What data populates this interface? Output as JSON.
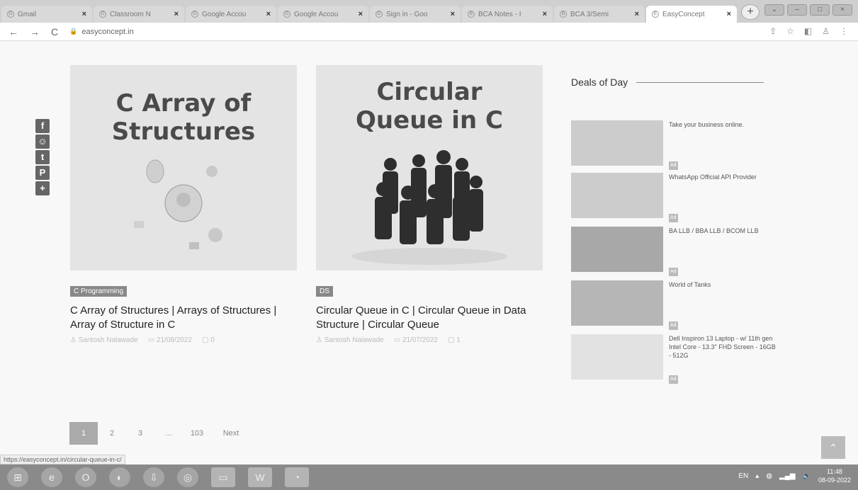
{
  "browser": {
    "tabs": [
      {
        "label": "Gmail",
        "icon": "G"
      },
      {
        "label": "Classroom N",
        "icon": "G"
      },
      {
        "label": "Google Accou",
        "icon": "G"
      },
      {
        "label": "Google Accou",
        "icon": "G"
      },
      {
        "label": "Sign in - Goo",
        "icon": "G"
      },
      {
        "label": "BCA Notes - I",
        "icon": "B"
      },
      {
        "label": "BCA 3/Semi",
        "icon": "B"
      },
      {
        "label": "EasyConcept",
        "icon": "E"
      }
    ],
    "new_tab": "+",
    "url": "easyconcept.in"
  },
  "share_icons": [
    "f",
    "☺",
    "t",
    "P",
    "+"
  ],
  "posts": [
    {
      "thumb_title": "C Array of Structures",
      "category": "C Programming",
      "title": "C Array of Structures | Arrays of Structures | Array of Structure in C",
      "author": "Santosh Nalawade",
      "date": "21/08/2022",
      "comments": "0"
    },
    {
      "thumb_title": "Circular Queue in C",
      "category": "DS",
      "title": "Circular Queue in C | Circular Queue in Data Structure | Circular Queue",
      "author": "Santosh Nalawade",
      "date": "21/07/2022",
      "comments": "1"
    }
  ],
  "sidebar": {
    "title": "Deals of Day",
    "deals": [
      {
        "text": "Take your business online."
      },
      {
        "text": "WhatsApp Official API Provider"
      },
      {
        "text": "BA LLB / BBA LLB / BCOM LLB"
      },
      {
        "text": "World of Tanks"
      },
      {
        "text": "Dell Inspiron 13 Laptop - w/ 11th gen Intel Core - 13.3\" FHD Screen - 16GB - 512G"
      }
    ]
  },
  "pagination": {
    "pages": [
      "1",
      "2",
      "3",
      "...",
      "103"
    ],
    "next": "Next"
  },
  "status_url": "https://easyconcept.in/circular-queue-in-c/",
  "taskbar": {
    "lang": "EN",
    "time": "11:48",
    "date": "08-09-2022"
  }
}
